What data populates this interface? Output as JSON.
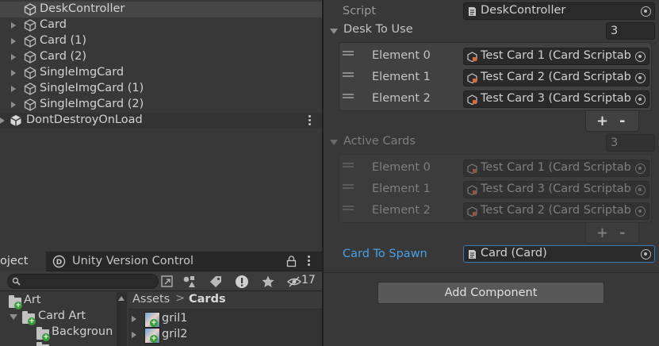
{
  "hierarchy": {
    "items": [
      {
        "label": "DeskController",
        "selected": true,
        "expandable": false
      },
      {
        "label": "Card",
        "expandable": true
      },
      {
        "label": "Card (1)",
        "expandable": true
      },
      {
        "label": "Card (2)",
        "expandable": true
      },
      {
        "label": "SingleImgCard",
        "expandable": true
      },
      {
        "label": "SingleImgCard (1)",
        "expandable": true
      },
      {
        "label": "SingleImgCard (2)",
        "expandable": true
      }
    ],
    "scene": {
      "label": "DontDestroyOnLoad"
    }
  },
  "inspector": {
    "script": {
      "label": "Script",
      "value": "DeskController"
    },
    "desk_to_use": {
      "label": "Desk To Use",
      "size": "3",
      "elements": [
        {
          "label": "Element 0",
          "value": "Test Card 1 (Card Scriptab"
        },
        {
          "label": "Element 1",
          "value": "Test Card 2 (Card Scriptab"
        },
        {
          "label": "Element 2",
          "value": "Test Card 3 (Card Scriptab"
        }
      ],
      "add_label": "+",
      "remove_label": "-"
    },
    "active_cards": {
      "label": "Active Cards",
      "size": "3",
      "elements": [
        {
          "label": "Element 0",
          "value": "Test Card 1 (Card Scriptab"
        },
        {
          "label": "Element 1",
          "value": "Test Card 3 (Card Scriptab"
        },
        {
          "label": "Element 2",
          "value": "Test Card 2 (Card Scriptab"
        }
      ],
      "add_label": "+",
      "remove_label": "-"
    },
    "card_to_spawn": {
      "label": "Card To Spawn",
      "value": "Card (Card)"
    },
    "add_component_label": "Add Component"
  },
  "project": {
    "tabs": [
      {
        "label": "oject",
        "active": true
      },
      {
        "label": "Unity Version Control",
        "active": false
      }
    ],
    "hidden_count": "17",
    "tree": [
      {
        "label": "Art"
      },
      {
        "label": "Card Art"
      },
      {
        "label": "Backgroun"
      }
    ],
    "breadcrumb": {
      "root": "Assets",
      "separator": ">",
      "current": "Cards"
    },
    "assets": [
      {
        "label": "gril1"
      },
      {
        "label": "gril2"
      }
    ]
  },
  "colors": {
    "panel_bg": "#383838",
    "field_bg": "#2a2a2a",
    "selection_bg": "#464646",
    "link_blue": "#4a9fe6",
    "focus_border": "#3a79bb"
  }
}
